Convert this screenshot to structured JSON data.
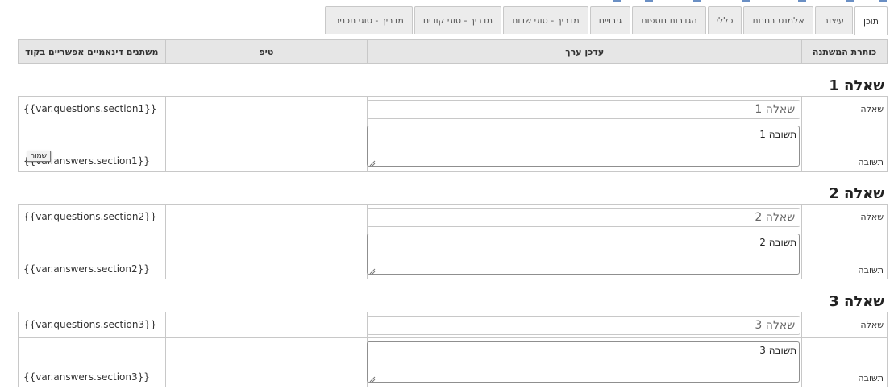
{
  "tabs": [
    {
      "label": "תוכן",
      "active": true
    },
    {
      "label": "עיצוב",
      "active": false
    },
    {
      "label": "אלמנט בחנות",
      "active": false
    },
    {
      "label": "כללי",
      "active": false
    },
    {
      "label": "הגדרות נוספות",
      "active": false
    },
    {
      "label": "גיבויים",
      "active": false
    },
    {
      "label": "מדריך - סוגי שדות",
      "active": false
    },
    {
      "label": "מדריך - סוגי קודים",
      "active": false
    },
    {
      "label": "מדריך - סוגי תכנים",
      "active": false
    }
  ],
  "header": {
    "title": "כותרת המשתנה",
    "editor": "עדכן ערך",
    "tip": "טיפ",
    "vars": "משתנים דינאמיים אפשריים בקוד"
  },
  "sections": [
    {
      "title": "שאלה 1",
      "question_label": "שאלה",
      "question_value": "שאלה 1",
      "question_var": "{{var.questions.section1}}",
      "answer_label": "תשובה",
      "answer_value": "תשובה 1",
      "answer_var": "{{var.answers.section1}}"
    },
    {
      "title": "שאלה 2",
      "question_label": "שאלה",
      "question_value": "שאלה 2",
      "question_var": "{{var.questions.section2}}",
      "answer_label": "תשובה",
      "answer_value": "תשובה 2",
      "answer_var": "{{var.answers.section2}}"
    },
    {
      "title": "שאלה 3",
      "question_label": "שאלה",
      "question_value": "שאלה 3",
      "question_var": "{{var.questions.section3}}",
      "answer_label": "תשובה",
      "answer_value": "תשובה 3",
      "answer_var": "{{var.answers.section3}}"
    }
  ],
  "tooltip": {
    "save_label": "שמור"
  }
}
